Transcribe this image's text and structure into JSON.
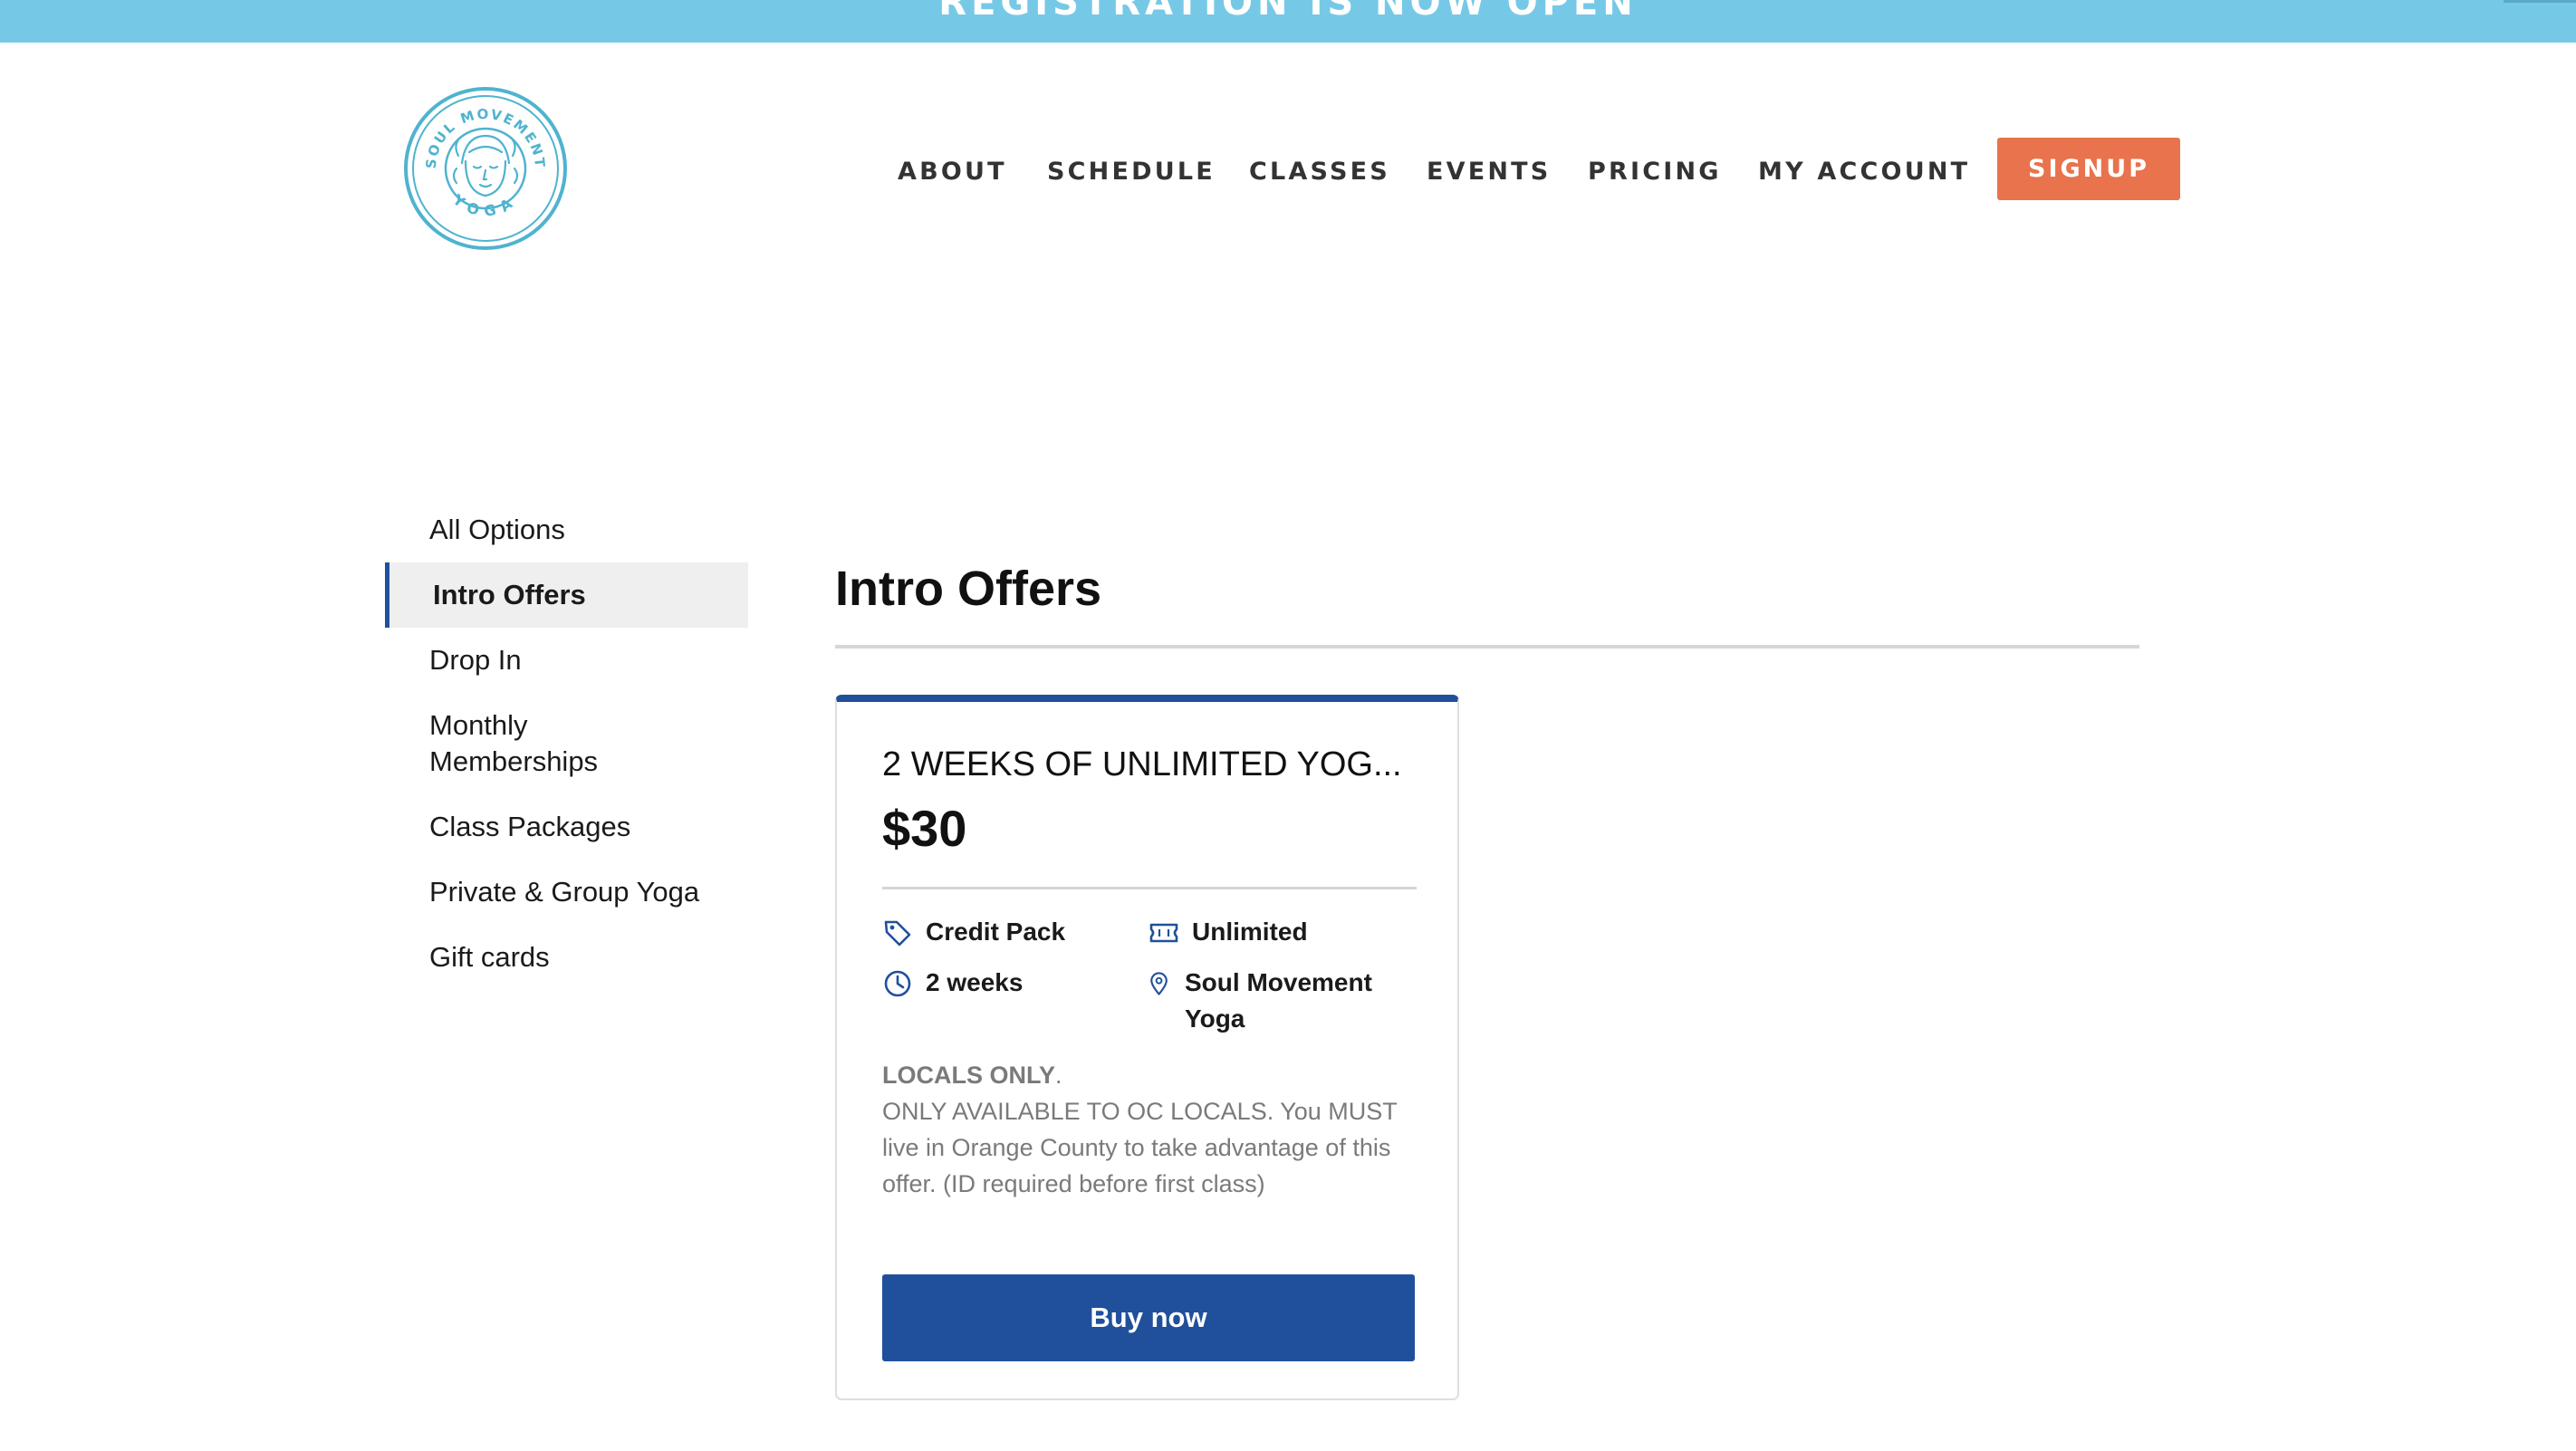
{
  "banner": {
    "text": "REGISTRATION IS NOW OPEN"
  },
  "logo": {
    "top_text": "SOUL MOVEMENT",
    "bottom_text": "YOGA",
    "color": "#4fb3cf"
  },
  "nav": {
    "items": [
      {
        "label": "ABOUT"
      },
      {
        "label": "SCHEDULE"
      },
      {
        "label": "CLASSES"
      },
      {
        "label": "EVENTS"
      },
      {
        "label": "PRICING"
      },
      {
        "label": "MY ACCOUNT"
      }
    ],
    "signup_label": "SIGNUP"
  },
  "sidebar": {
    "items": [
      {
        "label": "All Options",
        "active": false
      },
      {
        "label": "Intro Offers",
        "active": true
      },
      {
        "label": "Drop In",
        "active": false
      },
      {
        "label": "Monthly Memberships",
        "active": false
      },
      {
        "label": "Class Packages",
        "active": false
      },
      {
        "label": "Private & Group Yoga",
        "active": false
      },
      {
        "label": "Gift cards",
        "active": false
      }
    ]
  },
  "main": {
    "title": "Intro Offers",
    "card": {
      "title": "2 WEEKS OF UNLIMITED YOG...",
      "price": "$30",
      "details": {
        "type": {
          "label": "Credit Pack",
          "icon": "tag-icon"
        },
        "usage": {
          "label": "Unlimited",
          "icon": "ticket-icon"
        },
        "duration": {
          "label": "2 weeks",
          "icon": "clock-icon"
        },
        "location": {
          "label": "Soul Movement Yoga",
          "icon": "location-pin-icon"
        }
      },
      "description": {
        "headline": "LOCALS ONLY",
        "headline_suffix": ".",
        "body": "ONLY AVAILABLE TO OC LOCALS. You MUST live in Orange County to take advantage of this offer. (ID required before first class)"
      },
      "buy_label": "Buy now"
    }
  },
  "colors": {
    "banner": "#76c9e6",
    "accent_blue": "#20509c",
    "signup_orange": "#e8734c",
    "logo_teal": "#4fb3cf"
  }
}
